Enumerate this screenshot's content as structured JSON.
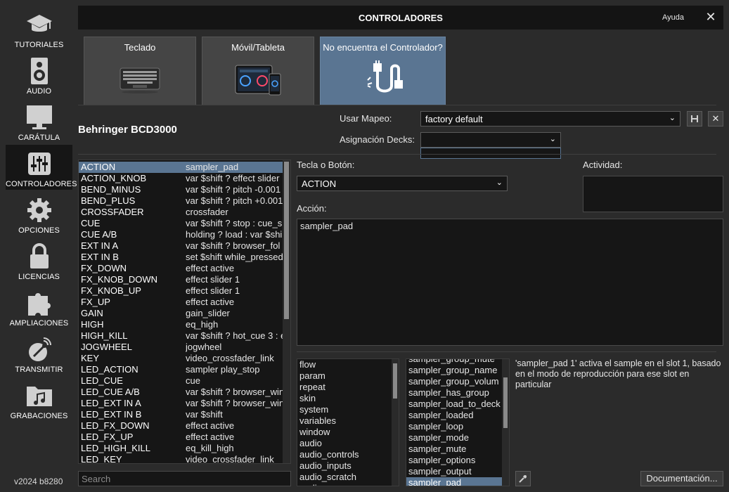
{
  "sidebar": {
    "items": [
      {
        "label": "TUTORIALES",
        "icon": "graduation-cap-icon"
      },
      {
        "label": "AUDIO",
        "icon": "speaker-icon"
      },
      {
        "label": "CARÁTULA",
        "icon": "monitor-icon"
      },
      {
        "label": "CONTROLADORES",
        "icon": "sliders-icon"
      },
      {
        "label": "OPCIONES",
        "icon": "gear-icon"
      },
      {
        "label": "LICENCIAS",
        "icon": "lock-icon"
      },
      {
        "label": "AMPLIACIONES",
        "icon": "puzzle-icon"
      },
      {
        "label": "TRANSMITIR",
        "icon": "broadcast-icon"
      },
      {
        "label": "GRABACIONES",
        "icon": "music-folder-icon"
      }
    ],
    "version": "v2024 b8280"
  },
  "header": {
    "title": "CONTROLADORES",
    "help": "Ayuda",
    "close": "✕"
  },
  "tabs": [
    {
      "label": "Teclado",
      "icon": "keyboard-icon"
    },
    {
      "label": "Móvil/Tableta",
      "icon": "tablet-phone-icon"
    },
    {
      "label": "No encuentra el Controlador?",
      "icon": "usb-cable-icon"
    }
  ],
  "device": {
    "name": "Behringer BCD3000"
  },
  "mapping": {
    "label": "Usar Mapeo:",
    "value": "factory default",
    "decks_label": "Asignación Decks:",
    "decks_value": ""
  },
  "keys": [
    {
      "key": "ACTION",
      "value": "sampler_pad"
    },
    {
      "key": "ACTION_KNOB",
      "value": "var $shift ? effect slider"
    },
    {
      "key": "BEND_MINUS",
      "value": "var $shift ? pitch -0.001"
    },
    {
      "key": "BEND_PLUS",
      "value": "var $shift ? pitch +0.001"
    },
    {
      "key": "CROSSFADER",
      "value": "crossfader"
    },
    {
      "key": "CUE",
      "value": "var $shift ? stop : cue_s"
    },
    {
      "key": "CUE A/B",
      "value": "holding ? load : var $shi"
    },
    {
      "key": "EXT IN A",
      "value": "var $shift ? browser_fol"
    },
    {
      "key": "EXT IN B",
      "value": "set $shift while_pressed"
    },
    {
      "key": "FX_DOWN",
      "value": "effect active"
    },
    {
      "key": "FX_KNOB_DOWN",
      "value": "effect slider 1"
    },
    {
      "key": "FX_KNOB_UP",
      "value": "effect slider 1"
    },
    {
      "key": "FX_UP",
      "value": "effect active"
    },
    {
      "key": "GAIN",
      "value": "gain_slider"
    },
    {
      "key": "HIGH",
      "value": "eq_high"
    },
    {
      "key": "HIGH_KILL",
      "value": "var $shift ? hot_cue 3 : e"
    },
    {
      "key": "JOGWHEEL",
      "value": "jogwheel"
    },
    {
      "key": "KEY",
      "value": "video_crossfader_link"
    },
    {
      "key": "LED_ACTION",
      "value": "sampler play_stop"
    },
    {
      "key": "LED_CUE",
      "value": "cue"
    },
    {
      "key": "LED_CUE A/B",
      "value": "var $shift ? browser_win"
    },
    {
      "key": "LED_EXT IN A",
      "value": "var $shift ? browser_win"
    },
    {
      "key": "LED_EXT IN B",
      "value": "var $shift"
    },
    {
      "key": "LED_FX_DOWN",
      "value": "effect active"
    },
    {
      "key": "LED_FX_UP",
      "value": "effect active"
    },
    {
      "key": "LED_HIGH_KILL",
      "value": "eq_kill_high"
    },
    {
      "key": "LED_KEY",
      "value": "video_crossfader_link"
    }
  ],
  "keys_scroll": 0.1,
  "search": {
    "placeholder": "Search"
  },
  "key_panel": {
    "label": "Tecla o Botón:",
    "value": "ACTION",
    "activity_label": "Actividad:",
    "action_label": "Acción:",
    "action_value": "sampler_pad"
  },
  "categories": [
    "flow",
    "param",
    "repeat",
    "skin",
    "system",
    "variables",
    "window",
    "audio",
    "audio_controls",
    "audio_inputs",
    "audio_scratch",
    "audio_sync"
  ],
  "verbs": [
    "sampler_group_mute",
    "sampler_group_name",
    "sampler_group_volum",
    "sampler_has_group",
    "sampler_load_to_deck",
    "sampler_loaded",
    "sampler_loop",
    "sampler_mode",
    "sampler_mute",
    "sampler_options",
    "sampler_output",
    "sampler_pad"
  ],
  "description": "'sampler_pad 1' activa el sample en el slot 1, basado en el modo de reproducción para ese slot en particular",
  "doc_button": "Documentación...",
  "colors": {
    "accent": "#5a7592",
    "background": "#2b2b2b",
    "panel": "#161616"
  }
}
